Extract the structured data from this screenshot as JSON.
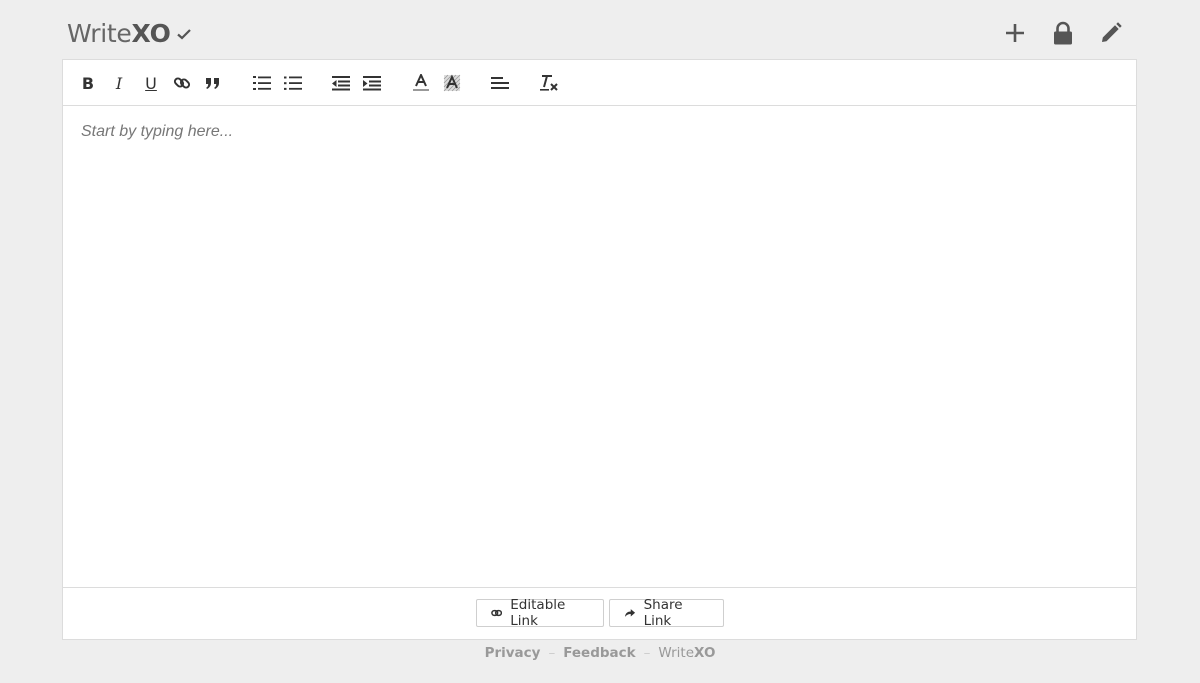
{
  "app": {
    "logo_write": "Write",
    "logo_xo": "XO"
  },
  "header_icons": [
    "plus-icon",
    "lock-icon",
    "pencil-icon"
  ],
  "toolbar": {
    "bold": "B",
    "italic": "I",
    "underline": "U",
    "icons": [
      "link-icon",
      "quote-icon",
      "ordered-list-icon",
      "bullet-list-icon",
      "outdent-icon",
      "indent-icon",
      "font-color-icon",
      "highlight-icon",
      "align-icon",
      "clear-format-icon"
    ]
  },
  "editor": {
    "placeholder": "Start by typing here..."
  },
  "buttons": {
    "editable_link": "Editable Link",
    "share_link": "Share Link"
  },
  "footer": {
    "privacy": "Privacy",
    "feedback": "Feedback",
    "brand_write": "Write",
    "brand_xo": "XO",
    "separator": "–"
  },
  "colors": {
    "background": "#eeeeee",
    "icon": "#555555"
  }
}
